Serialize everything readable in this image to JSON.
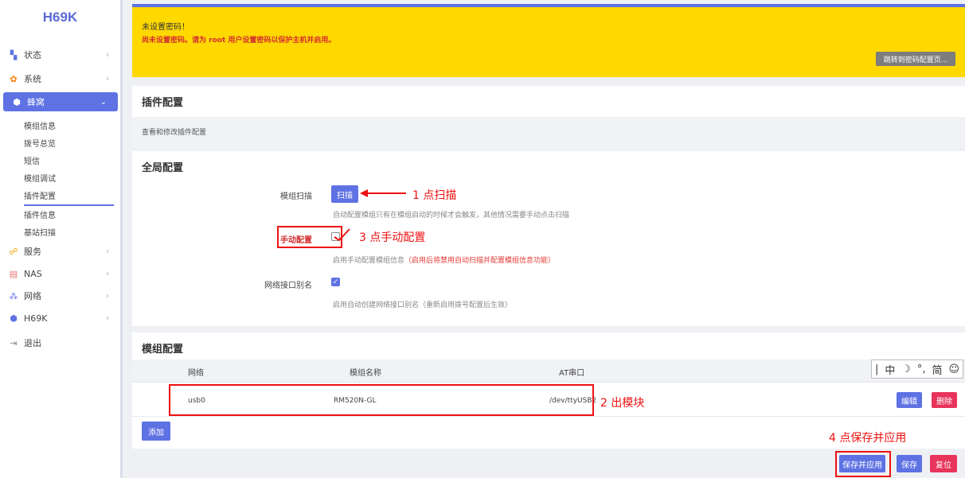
{
  "sidebar": {
    "brand": "H69K",
    "items": [
      {
        "label": "状态",
        "icon": "dashboard-icon"
      },
      {
        "label": "系统",
        "icon": "gear-icon"
      },
      {
        "label": "蜂窝",
        "icon": "cellular-icon"
      },
      {
        "label": "服务",
        "icon": "link-icon"
      },
      {
        "label": "NAS",
        "icon": "storage-icon"
      },
      {
        "label": "网络",
        "icon": "network-icon"
      },
      {
        "label": "H69K",
        "icon": "cellular-icon"
      },
      {
        "label": "退出",
        "icon": "logout-icon"
      }
    ],
    "subitems": [
      "模组信息",
      "拨号总览",
      "短信",
      "模组调试",
      "插件配置",
      "插件信息",
      "基站扫描"
    ]
  },
  "banner": {
    "title": "未设置密码！",
    "message": "尚未设置密码。请为 root 用户设置密码以保护主机并启用。",
    "button": "跳转到密码配置页..."
  },
  "plugin_panel": {
    "title": "插件配置",
    "desc": "查看和修改插件配置"
  },
  "global_panel": {
    "title": "全局配置",
    "scan_label": "模组扫描",
    "scan_button": "扫描",
    "scan_hint": "自动配置模组只有在模组启动的时候才会触发，其他情况需要手动点击扫描",
    "manual_label": "手动配置",
    "manual_hint_prefix": "启用手动配置模组信息",
    "manual_hint_red": "（启用后将禁用自动扫描并配置模组信息功能）",
    "alias_label": "网络接口别名",
    "alias_hint": "启用自动创建网络接口别名（重新启用拨号配置后生效）",
    "alias_checked": true,
    "manual_checked": false
  },
  "module_panel": {
    "title": "模组配置",
    "columns": [
      "网络",
      "模组名称",
      "AT串口"
    ],
    "rows": [
      {
        "network": "usb0",
        "name": "RM520N-GL",
        "port": "/dev/ttyUSB2",
        "edit": "编辑",
        "delete": "删除"
      }
    ],
    "add_button": "添加"
  },
  "footer": {
    "save_apply": "保存并应用",
    "save": "保存",
    "reset": "复位"
  },
  "annotations": {
    "a1": "1 点扫描",
    "a2": "2 出模块",
    "a3": "3 点手动配置",
    "a4": "4 点保存并应用"
  },
  "ime": [
    "中",
    "简"
  ]
}
